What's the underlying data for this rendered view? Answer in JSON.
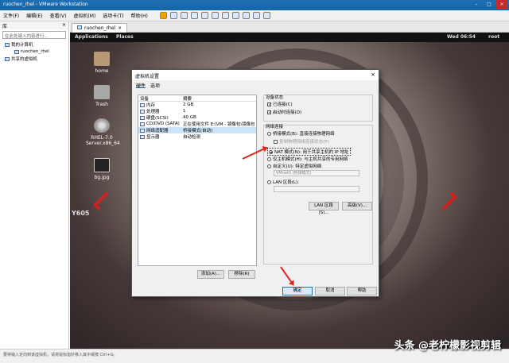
{
  "window": {
    "title": "ruochen_rhel - VMware Workstation"
  },
  "menu": [
    "文件(F)",
    "编辑(E)",
    "查看(V)",
    "虚拟机(M)",
    "选项卡(T)",
    "帮助(H)"
  ],
  "library": {
    "title": "库",
    "close": "×",
    "search_placeholder": "在此处键入内容进行...",
    "items": {
      "my_computer": "我的计算机",
      "vm": "ruochen_rhel",
      "shared": "共享的虚拟机"
    }
  },
  "vm_tab": {
    "label": "ruochen_rhel",
    "close": "×"
  },
  "gnome": {
    "applications": "Applications",
    "places": "Places",
    "clock": "Wed 06:54",
    "user": "root"
  },
  "desktop": {
    "icons": [
      {
        "label": "home"
      },
      {
        "label": "Trash"
      },
      {
        "label": "RHEL-7.0 Server.x86_64"
      },
      {
        "label": "bg.jpg"
      }
    ],
    "tag": "Y605"
  },
  "dialog": {
    "title": "虚拟机设置",
    "close": "×",
    "tabs": [
      "硬件",
      "选项"
    ],
    "device_headers": {
      "device": "设备",
      "summary": "摘要"
    },
    "devices": [
      {
        "name": "内存",
        "summary": "2 GB"
      },
      {
        "name": "处理器",
        "summary": "1"
      },
      {
        "name": "硬盘(SCSI)",
        "summary": "40 GB"
      },
      {
        "name": "CD/DVD (SATA)",
        "summary": "正在使用文件 E:\\VM - 镜像包\\镜像包..."
      },
      {
        "name": "网络适配器",
        "summary": "桥接模式(自动)"
      },
      {
        "name": "显示器",
        "summary": "自动检测"
      }
    ],
    "add_button": "添加(A)...",
    "remove_button": "移除(R)",
    "device_status": {
      "title": "设备状态",
      "connected": "已连接(C)",
      "connect_on_power": "启动时连接(O)"
    },
    "network": {
      "title": "网络连接",
      "bridged": "桥接模式(B): 直接连接物理网络",
      "replicate": "复制物理网络连接状态(P)",
      "nat": "NAT 模式(N): 用于共享主机的 IP 地址",
      "host_only": "仅主机模式(H): 与主机共享的专用网络",
      "custom": "自定义(U): 特定虚拟网络",
      "custom_value": "VMnet0 (桥接模式)",
      "lan": "LAN 区段(L):",
      "lan_value": ""
    },
    "lan_segments_button": "LAN 区段(S)...",
    "advanced_button": "高级(V)...",
    "ok_button": "确定",
    "cancel_button": "取消",
    "help_button": "帮助"
  },
  "statusbar": "要将输入定向到该虚拟机，请将鼠标指针移入其中或按 Ctrl+G。",
  "watermark": "头条 @老柠檬影视剪辑"
}
